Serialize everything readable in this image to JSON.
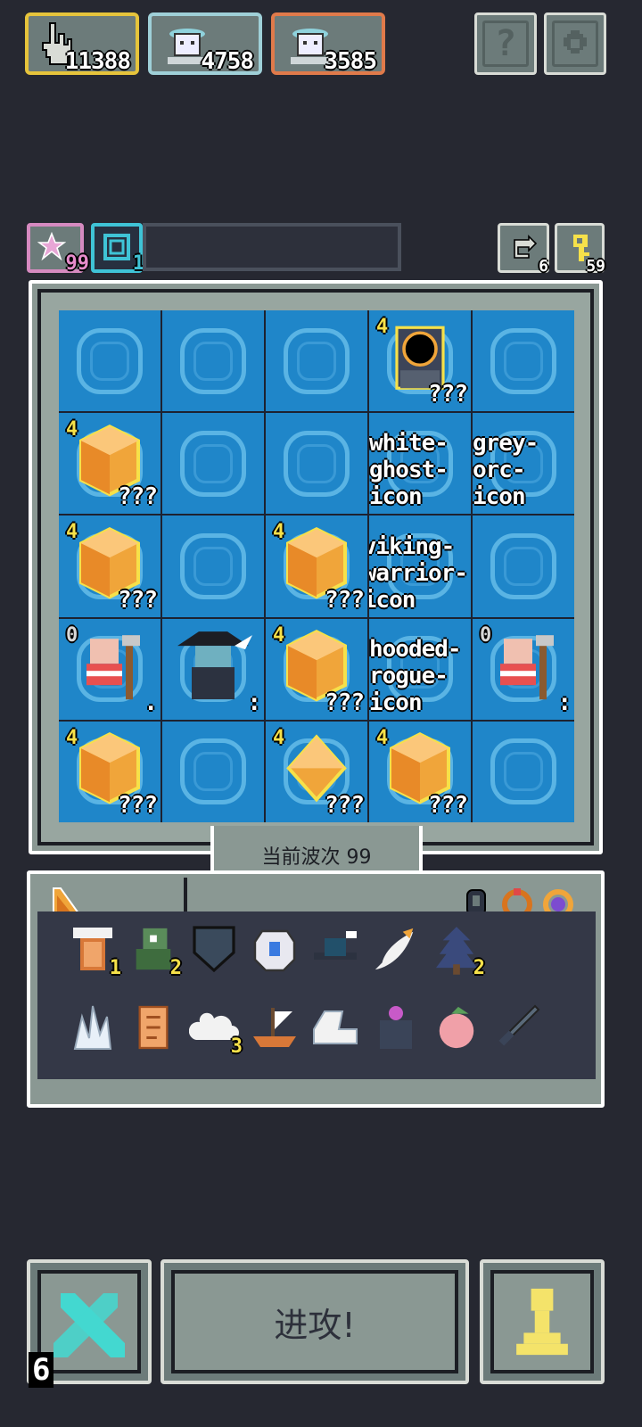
{
  "currencies": [
    {
      "icon": "cursor-hand-icon",
      "value": "11388",
      "border": "#e6c43b"
    },
    {
      "icon": "ghost-spirit-icon",
      "value": "4758",
      "border": "#9fd0d8"
    },
    {
      "icon": "ghost-spirit-red-icon",
      "value": "3585",
      "border": "#e07a4a"
    }
  ],
  "top_buttons": {
    "help": "?",
    "settings_icon": "gear-icon"
  },
  "status": {
    "star_count": "99",
    "clock_count": "1",
    "refresh_count": "6",
    "key_count": "59"
  },
  "board": {
    "cells": [
      [
        "",
        "",
        "",
        "4|???|dark-portal-icon",
        ""
      ],
      [
        "4|???|amber-crystal-icon",
        "",
        "",
        "|white-ghost-icon",
        "|grey-orc-icon"
      ],
      [
        "4|???|amber-crystal-icon",
        "",
        "4|???|amber-crystal-icon",
        "|viking-warrior-icon",
        ""
      ],
      [
        "0|.|old-pirate-icon",
        "|:|wizard-hat-icon",
        "4|???|amber-crystal-icon",
        "|hooded-rogue-icon",
        "0|:|old-pirate-icon"
      ],
      [
        "4|???|amber-crystal-icon",
        "",
        "4|???|amber-gem-icon",
        "4|???|amber-crystal-icon",
        ""
      ]
    ],
    "wave_label": "当前波次 99"
  },
  "inventory": {
    "tab_icon": "orange-wedge-icon",
    "equip_icons": [
      "dark-beetle-icon",
      "bronze-ring-icon",
      "purple-ring-icon"
    ],
    "row1": [
      {
        "icon": "paper-lantern-icon",
        "count": "1"
      },
      {
        "icon": "green-goblin-icon",
        "count": "2"
      },
      {
        "icon": "blue-shield-icon",
        "count": ""
      },
      {
        "icon": "sapphire-badge-icon",
        "count": ""
      },
      {
        "icon": "black-hat-icon",
        "count": ""
      },
      {
        "icon": "feather-icon",
        "count": ""
      },
      {
        "icon": "pine-tree-icon",
        "count": "2"
      }
    ],
    "row2": [
      {
        "icon": "ice-crystal-icon",
        "count": ""
      },
      {
        "icon": "scroll-icon",
        "count": ""
      },
      {
        "icon": "cloud-icon",
        "count": "3"
      },
      {
        "icon": "sailing-ship-icon",
        "count": ""
      },
      {
        "icon": "white-boot-icon",
        "count": ""
      },
      {
        "icon": "dark-flower-icon",
        "count": ""
      },
      {
        "icon": "peach-fruit-icon",
        "count": ""
      },
      {
        "icon": "short-sword-icon",
        "count": ""
      }
    ]
  },
  "bottom": {
    "swords_count": "6",
    "attack_label": "进攻!",
    "pawn_icon": "pawn-icon"
  },
  "colors": {
    "background": "#262831",
    "water": "#1f86c9",
    "panel": "#8a9893",
    "accent": "#f6e14a"
  }
}
